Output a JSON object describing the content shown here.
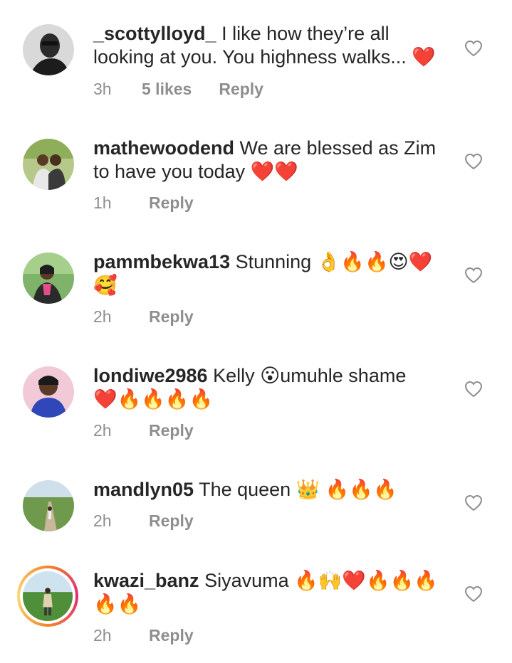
{
  "comments": [
    {
      "username": "_scottylloyd_",
      "text_line1": " I like how they’re all",
      "text_line2": "looking at you. You highness walks... ❤️",
      "time": "3h",
      "likes": "5 likes",
      "reply": "Reply",
      "avatar_icon": "avatar-man-sunglasses"
    },
    {
      "username": "mathewoodend",
      "text_line1": " We are blessed as Zim",
      "text_line2": "to have you today ❤️❤️",
      "time": "1h",
      "reply": "Reply",
      "avatar_icon": "avatar-couple"
    },
    {
      "username": "pammbekwa13",
      "text_line1": " Stunning 👌🔥🔥😍❤️",
      "text_line2": "🥰",
      "time": "2h",
      "reply": "Reply",
      "avatar_icon": "avatar-woman-outdoors"
    },
    {
      "username": "londiwe2986",
      "text_line1": " Kelly 😮umuhle shame",
      "text_line2": "❤️🔥🔥🔥🔥",
      "time": "2h",
      "reply": "Reply",
      "avatar_icon": "avatar-woman-pink-bg"
    },
    {
      "username": "mandlyn05",
      "text_line1": " The queen 👑 🔥🔥🔥",
      "time": "2h",
      "reply": "Reply",
      "avatar_icon": "avatar-landscape-road"
    },
    {
      "username": "kwazi_banz",
      "text_line1": " Siyavuma 🔥🙌❤️🔥🔥🔥",
      "text_line2": "🔥🔥",
      "time": "2h",
      "reply": "Reply",
      "avatar_icon": "avatar-field-story-ring"
    }
  ],
  "icons": {
    "like": "heart-outline-icon"
  },
  "colors": {
    "text": "#262626",
    "meta": "#8e8e8e",
    "background": "#ffffff"
  }
}
